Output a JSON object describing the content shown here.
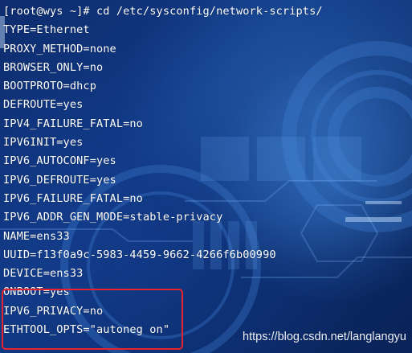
{
  "terminal": {
    "lines": [
      "[root@wys ~]# cd /etc/sysconfig/network-scripts/",
      "TYPE=Ethernet",
      "PROXY_METHOD=none",
      "BROWSER_ONLY=no",
      "BOOTPROTO=dhcp",
      "DEFROUTE=yes",
      "IPV4_FAILURE_FATAL=no",
      "IPV6INIT=yes",
      "IPV6_AUTOCONF=yes",
      "IPV6_DEFROUTE=yes",
      "IPV6_FAILURE_FATAL=no",
      "IPV6_ADDR_GEN_MODE=stable-privacy",
      "NAME=ens33",
      "UUID=f13f0a9c-5983-4459-9662-4266f6b00990",
      "DEVICE=ens33",
      "ONBOOT=yes",
      "IPV6_PRIVACY=no",
      "ETHTOOL_OPTS=\"autoneg on\""
    ]
  },
  "watermark": {
    "text": "https://blog.csdn.net/langlangyu"
  },
  "colors": {
    "terminal_text": "#ffffff",
    "highlight_border": "#e8232e",
    "background": "#103a86"
  }
}
